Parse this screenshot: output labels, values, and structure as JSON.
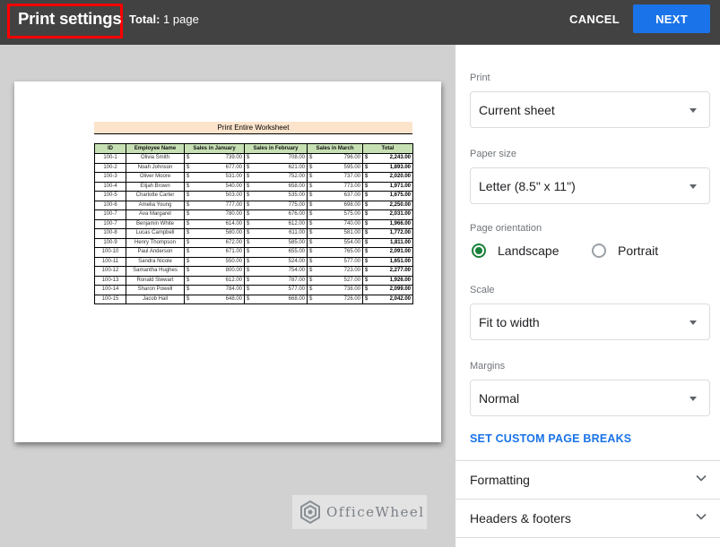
{
  "header": {
    "title": "Print settings",
    "total_label": "Total:",
    "total_value": "1 page",
    "cancel_label": "CANCEL",
    "next_label": "NEXT",
    "accent_color": "#1a73e8",
    "highlight_color": "#ff0000"
  },
  "preview": {
    "sheet_title": "Print Entire Worksheet",
    "columns": [
      "ID",
      "Employee Name",
      "Sales in January",
      "Sales in February",
      "Sales in March",
      "Total"
    ],
    "currency": "$",
    "rows": [
      {
        "id": "100-1",
        "name": "Olivia Smith",
        "jan": "739.00",
        "feb": "708.00",
        "mar": "796.00",
        "total": "2,243.00"
      },
      {
        "id": "100-2",
        "name": "Noah Johnson",
        "jan": "677.00",
        "feb": "621.00",
        "mar": "595.00",
        "total": "1,893.00"
      },
      {
        "id": "100-3",
        "name": "Oliver Moore",
        "jan": "531.00",
        "feb": "752.00",
        "mar": "737.00",
        "total": "2,020.00"
      },
      {
        "id": "100-4",
        "name": "Elijah Brown",
        "jan": "540.00",
        "feb": "658.00",
        "mar": "773.00",
        "total": "1,971.00"
      },
      {
        "id": "100-5",
        "name": "Charlotte Carter",
        "jan": "503.00",
        "feb": "535.00",
        "mar": "637.00",
        "total": "1,675.00"
      },
      {
        "id": "100-6",
        "name": "Amelia Young",
        "jan": "777.00",
        "feb": "775.00",
        "mar": "698.00",
        "total": "2,250.00"
      },
      {
        "id": "100-7",
        "name": "Ava Margaret",
        "jan": "780.00",
        "feb": "676.00",
        "mar": "575.00",
        "total": "2,031.00"
      },
      {
        "id": "100-7",
        "name": "Benjamin White",
        "jan": "614.00",
        "feb": "612.00",
        "mar": "740.00",
        "total": "1,966.00"
      },
      {
        "id": "100-8",
        "name": "Lucas Campbell",
        "jan": "580.00",
        "feb": "611.00",
        "mar": "581.00",
        "total": "1,772.00"
      },
      {
        "id": "100-9",
        "name": "Henry Thompson",
        "jan": "672.00",
        "feb": "585.00",
        "mar": "554.00",
        "total": "1,811.00"
      },
      {
        "id": "100-10",
        "name": "Paul Anderson",
        "jan": "671.00",
        "feb": "655.00",
        "mar": "765.00",
        "total": "2,091.00"
      },
      {
        "id": "100-11",
        "name": "Sandra Nicole",
        "jan": "550.00",
        "feb": "524.00",
        "mar": "577.00",
        "total": "1,651.00"
      },
      {
        "id": "100-12",
        "name": "Samantha Hughes",
        "jan": "800.00",
        "feb": "754.00",
        "mar": "723.00",
        "total": "2,277.00"
      },
      {
        "id": "100-13",
        "name": "Ronald Stewart",
        "jan": "612.00",
        "feb": "787.00",
        "mar": "527.00",
        "total": "1,926.00"
      },
      {
        "id": "100-14",
        "name": "Sharon Powell",
        "jan": "784.00",
        "feb": "577.00",
        "mar": "738.00",
        "total": "2,099.00"
      },
      {
        "id": "100-15",
        "name": "Jacob Hall",
        "jan": "648.00",
        "feb": "668.00",
        "mar": "726.00",
        "total": "2,042.00"
      }
    ],
    "title_fill_color": "#fce4cc",
    "header_fill_color": "#c6e0b4"
  },
  "watermark": {
    "text": "OfficeWheel",
    "icon": "officewheel-logo-icon"
  },
  "settings": {
    "print": {
      "label": "Print",
      "value": "Current sheet"
    },
    "paper_size": {
      "label": "Paper size",
      "value": "Letter (8.5\" x 11\")"
    },
    "orientation": {
      "label": "Page orientation",
      "options": [
        {
          "label": "Landscape",
          "selected": true
        },
        {
          "label": "Portrait",
          "selected": false
        }
      ],
      "selected_color": "#188038"
    },
    "scale": {
      "label": "Scale",
      "value": "Fit to width"
    },
    "margins": {
      "label": "Margins",
      "value": "Normal"
    },
    "custom_breaks_link": "SET CUSTOM PAGE BREAKS",
    "sections": [
      {
        "label": "Formatting",
        "icon": "chevron-down-icon"
      },
      {
        "label": "Headers & footers",
        "icon": "chevron-down-icon"
      }
    ]
  }
}
